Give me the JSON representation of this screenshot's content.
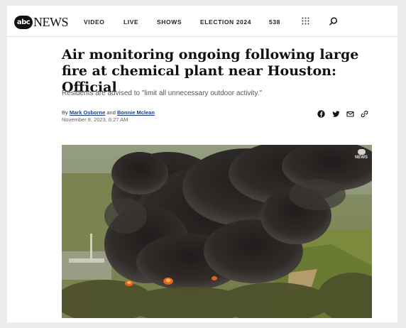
{
  "nav": {
    "logo_abc": "abc",
    "logo_news": "NEWS",
    "items": [
      "VIDEO",
      "LIVE",
      "SHOWS",
      "ELECTION 2024",
      "538"
    ]
  },
  "article": {
    "headline": "Air monitoring ongoing following large fire at chemical plant near Houston: Official",
    "subhead": "Residents are advised to \"limit all unnecessary outdoor activity.\"",
    "byline_prefix": "By",
    "author1": "Mark Osborne",
    "byline_and": "and",
    "author2": "Bonnie Mclean",
    "date": "November 9, 2023, 6:27 AM"
  },
  "share_icons": [
    "facebook-icon",
    "twitter-icon",
    "email-icon",
    "link-icon"
  ],
  "hero": {
    "watermark": "NEWS",
    "sky_color": "#9aa18a",
    "smoke_color": "#2b2826",
    "tree_color": "#6e7a3c",
    "fire_color": "#e0621e"
  }
}
